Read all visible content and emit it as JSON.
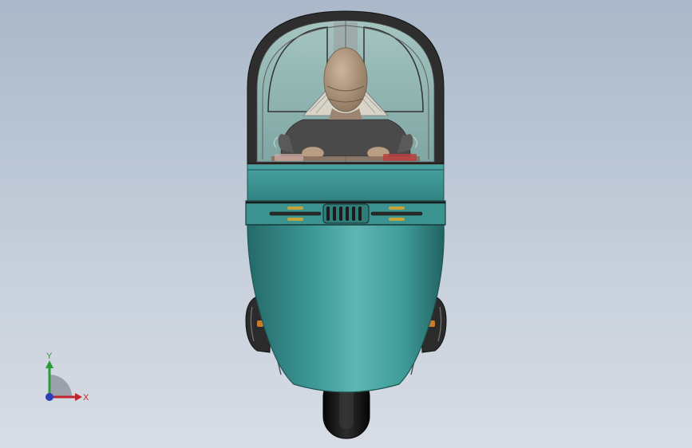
{
  "viewport": {
    "background_top": "#aab8c9",
    "background_bottom": "#d8dde5"
  },
  "model": {
    "body_color": "#3e9a98",
    "body_highlight": "#62b8b4",
    "body_shadow": "#26706f",
    "canopy_frame": "#3a3a3a",
    "glass_tint": "#8fb3b0",
    "rider_skin": "#b89e84",
    "rider_shirt": "#4a4a4a",
    "tire_color": "#1a1a1a",
    "accent_orange": "#c67c2a",
    "accent_red": "#b84040"
  },
  "triad": {
    "x_label": "X",
    "y_label": "Y",
    "x_color": "#c0272d",
    "y_color": "#2e9a3a",
    "z_color": "#2b3fb8"
  }
}
